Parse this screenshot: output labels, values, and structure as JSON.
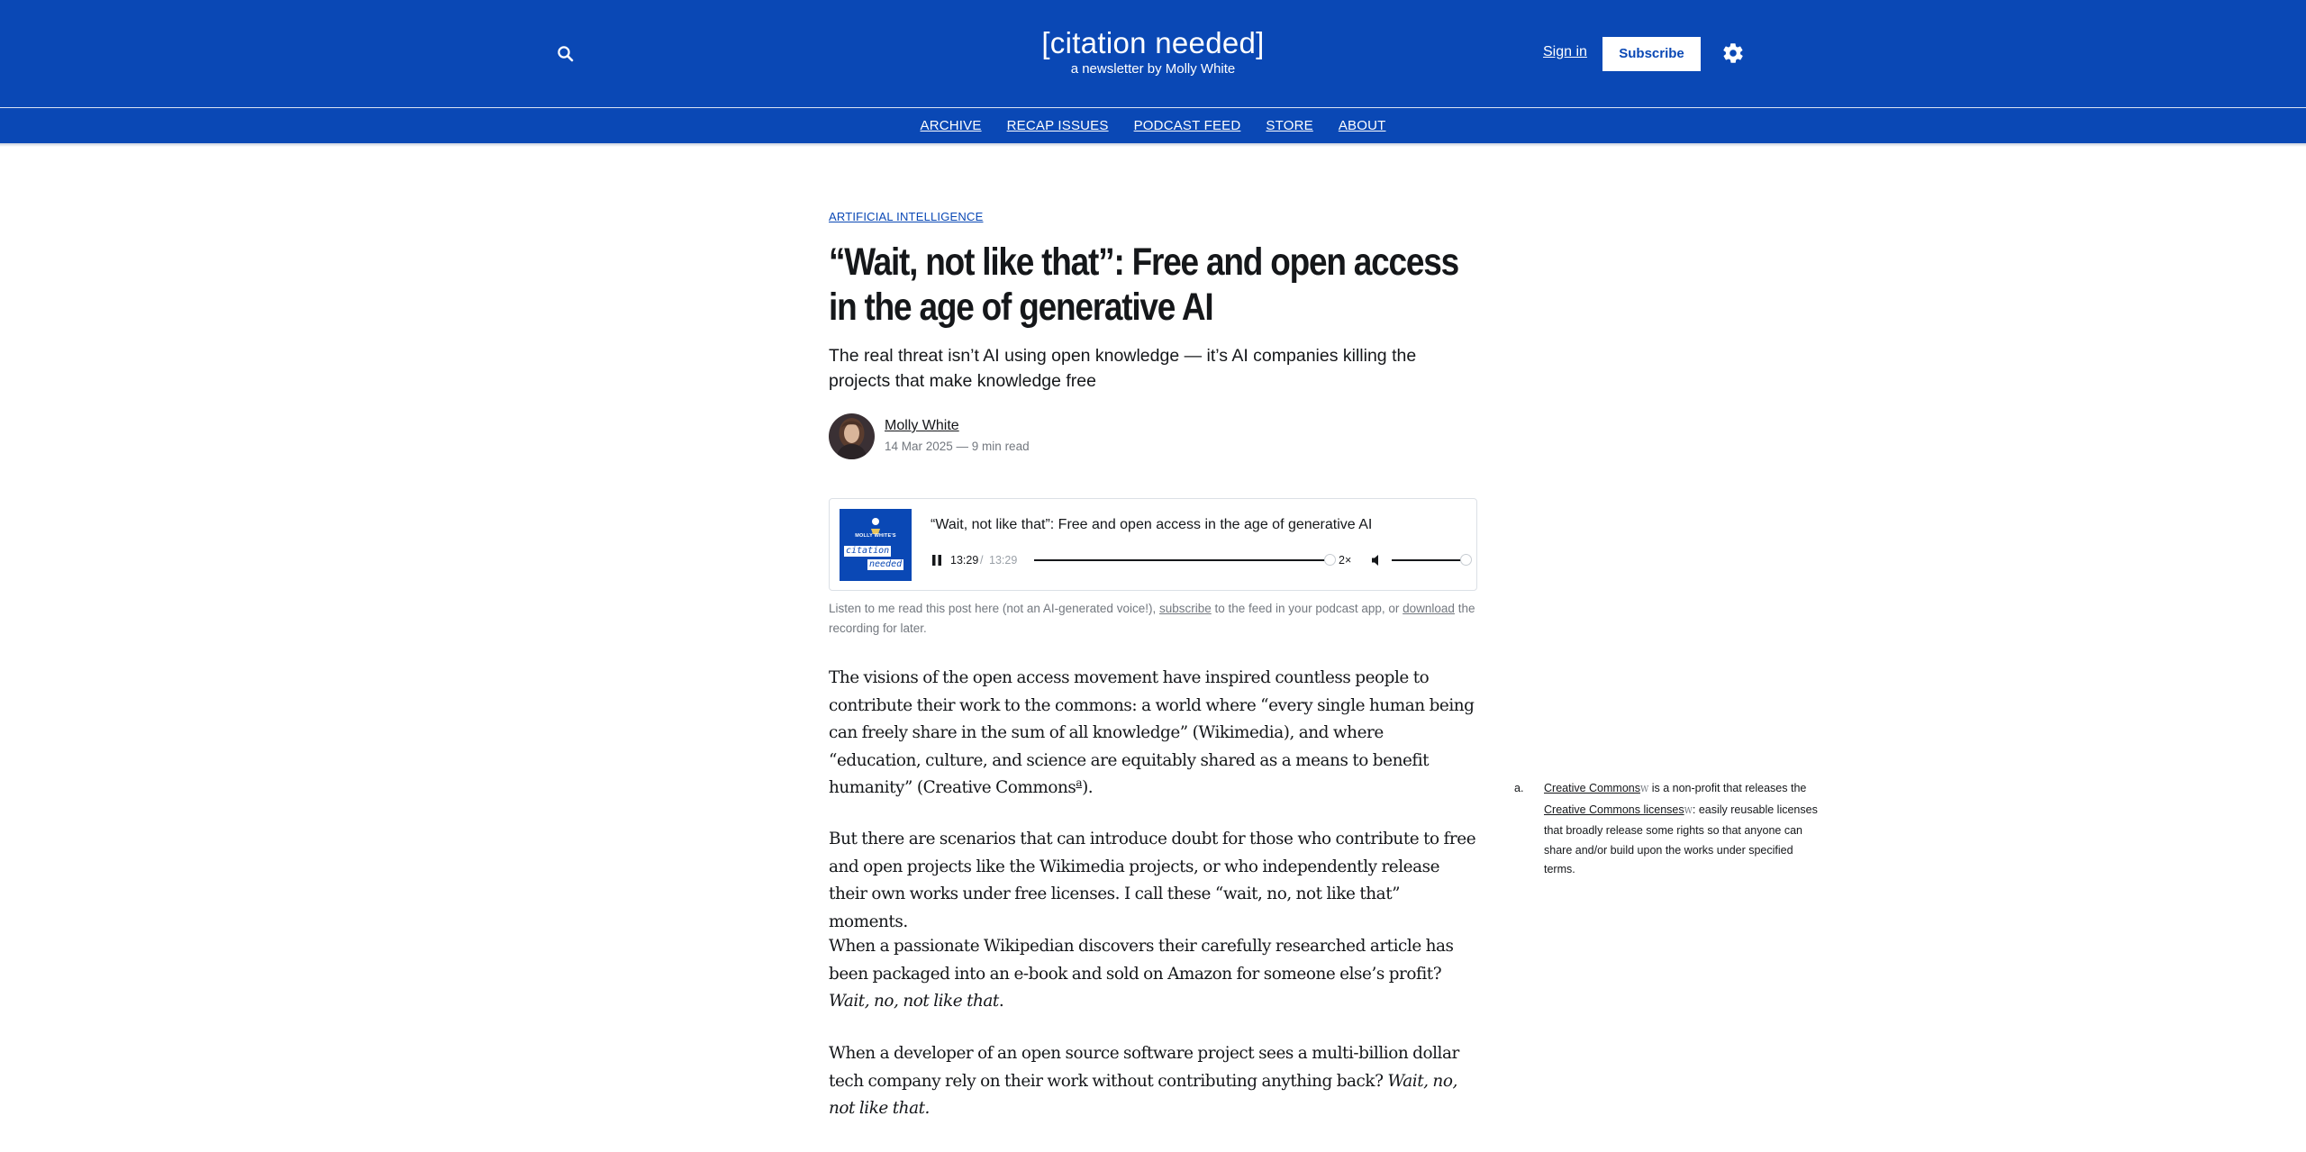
{
  "site": {
    "title": "[citation needed]",
    "tagline": "a newsletter by Molly White",
    "signin_label": "Sign in",
    "subscribe_label": "Subscribe",
    "brand_color": "#0a48b5",
    "icons": {
      "search": "search-icon",
      "settings": "gear-icon"
    }
  },
  "nav": {
    "items": [
      {
        "label": "ARCHIVE"
      },
      {
        "label": "RECAP ISSUES"
      },
      {
        "label": "PODCAST FEED"
      },
      {
        "label": "STORE"
      },
      {
        "label": "ABOUT"
      }
    ]
  },
  "article": {
    "tag": "ARTIFICIAL INTELLIGENCE",
    "title": "“Wait, not like that”: Free and open access in the age of generative AI",
    "dek": "The real threat isn’t AI using open knowledge — it’s AI companies killing the projects that make knowledge free",
    "author": "Molly White",
    "meta": "14 Mar 2025 — 9 min read"
  },
  "player": {
    "title": "“Wait, not like that”: Free and open access in the age of generative AI",
    "cover": {
      "line1": "MOLLY WHITE'S",
      "line2": "citation",
      "line3": "needed"
    },
    "current_time": "13:29",
    "separator": "/",
    "total_time": "13:29",
    "progress": 1.0,
    "speed": "2×",
    "volume": 1.0,
    "state": "playing"
  },
  "caption": {
    "part1": "Listen to me read this post here (not an AI-generated voice!), ",
    "subscribe_link": "subscribe",
    "part2": " to the feed in your podcast app, or ",
    "download_link": "download",
    "part3": " the recording for later."
  },
  "body": {
    "p1_text": "The visions of the open access movement have inspired countless people to contribute their work to the commons: a world where “every single human being can freely share in the sum of all knowledge” (Wikimedia), and where “education, culture, and science are equitably shared as a means to benefit humanity” (Creative Commons",
    "p1_ref": "a",
    "p1_end": ").",
    "p2": "But there are scenarios that can introduce doubt for those who contribute to free and open projects like the Wikimedia projects, or who independently release their own works under free licenses. I call these “wait, no, not like that” moments.",
    "p3_text": "When a passionate Wikipedian discovers their carefully researched article has been packaged into an e-book and sold on Amazon for someone else’s profit? ",
    "p3_em": "Wait, no, not like that",
    "p3_end": ".",
    "p4_text": "When a developer of an open source software project sees a multi-billion dollar tech company rely on their work without contributing anything back? ",
    "p4_em": "Wait, no, not like that."
  },
  "sidenote": {
    "label": "a.",
    "link1": "Creative Commons",
    "wk1": "W",
    "text1": " is a non-profit that releases the ",
    "link2": "Creative Commons licenses",
    "wk2": "W",
    "text2": ": easily reusable licenses that broadly release some rights so that anyone can share and/or build upon the works under specified terms."
  }
}
